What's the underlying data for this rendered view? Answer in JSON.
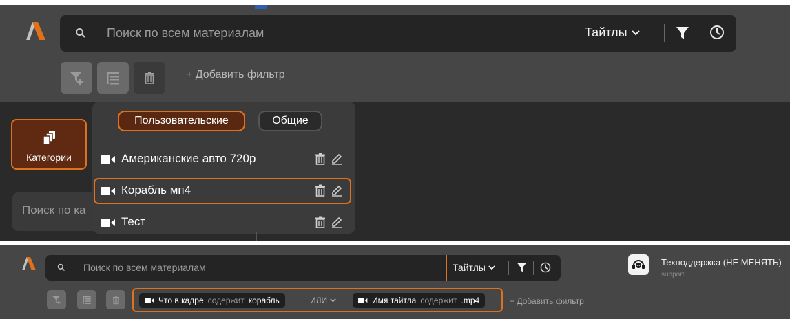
{
  "colors": {
    "accent": "#e0711c",
    "panel": "#464646",
    "surface": "#242424",
    "logo": "#e0711c"
  },
  "top": {
    "search": {
      "placeholder": "Поиск по всем материалам",
      "scope_label": "Тайтлы"
    },
    "filter_toolbar": {
      "add_filter_label": "+ Добавить фильтр"
    },
    "categories_button_label": "Категории",
    "category_search_placeholder": "Поиск по ка",
    "dropdown": {
      "tabs": [
        {
          "label": "Пользовательские",
          "active": true
        },
        {
          "label": "Общие",
          "active": false
        }
      ],
      "items": [
        {
          "name": "Американские авто 720p",
          "selected": false
        },
        {
          "name": "Корабль мп4",
          "selected": true
        },
        {
          "name": "Тест",
          "selected": false
        }
      ]
    }
  },
  "bottom": {
    "search": {
      "placeholder": "Поиск по всем материалам",
      "scope_label": "Тайтлы"
    },
    "support": {
      "title": "Техподдержка (НЕ МЕНЯТЬ)",
      "subtitle": "support"
    },
    "filters": [
      {
        "field": "Что в кадре",
        "operator": "содержит",
        "value": "корабль"
      },
      {
        "field": "Имя тайтла",
        "operator": "содержит",
        "value": ".mp4"
      }
    ],
    "logic_operator": "ИЛИ",
    "add_filter_label": "+ Добавить фильтр"
  }
}
